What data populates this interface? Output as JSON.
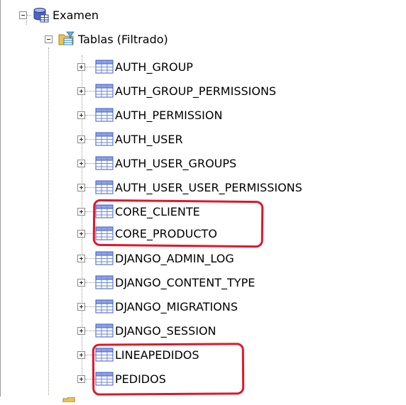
{
  "tree": {
    "root": {
      "label": "Examen",
      "icon": "database-icon",
      "expanded": true
    },
    "folder": {
      "label": "Tablas (Filtrado)",
      "icon": "filtered-folder-icon",
      "expanded": true
    },
    "tables": [
      {
        "label": "AUTH_GROUP",
        "icon": "table-icon"
      },
      {
        "label": "AUTH_GROUP_PERMISSIONS",
        "icon": "table-icon"
      },
      {
        "label": "AUTH_PERMISSION",
        "icon": "table-icon"
      },
      {
        "label": "AUTH_USER",
        "icon": "table-icon"
      },
      {
        "label": "AUTH_USER_GROUPS",
        "icon": "table-icon"
      },
      {
        "label": "AUTH_USER_USER_PERMISSIONS",
        "icon": "table-icon"
      },
      {
        "label": "CORE_CLIENTE",
        "icon": "table-icon"
      },
      {
        "label": "CORE_PRODUCTO",
        "icon": "table-icon"
      },
      {
        "label": "DJANGO_ADMIN_LOG",
        "icon": "table-icon"
      },
      {
        "label": "DJANGO_CONTENT_TYPE",
        "icon": "table-icon"
      },
      {
        "label": "DJANGO_MIGRATIONS",
        "icon": "table-icon"
      },
      {
        "label": "DJANGO_SESSION",
        "icon": "table-icon"
      },
      {
        "label": "LINEAPEDIDOS",
        "icon": "table-icon"
      },
      {
        "label": "PEDIDOS",
        "icon": "table-icon"
      }
    ]
  },
  "annotations": {
    "highlight_color": "#e0162b",
    "highlighted_groups": [
      [
        "CORE_CLIENTE",
        "CORE_PRODUCTO"
      ],
      [
        "LINEAPEDIDOS",
        "PEDIDOS"
      ]
    ]
  }
}
